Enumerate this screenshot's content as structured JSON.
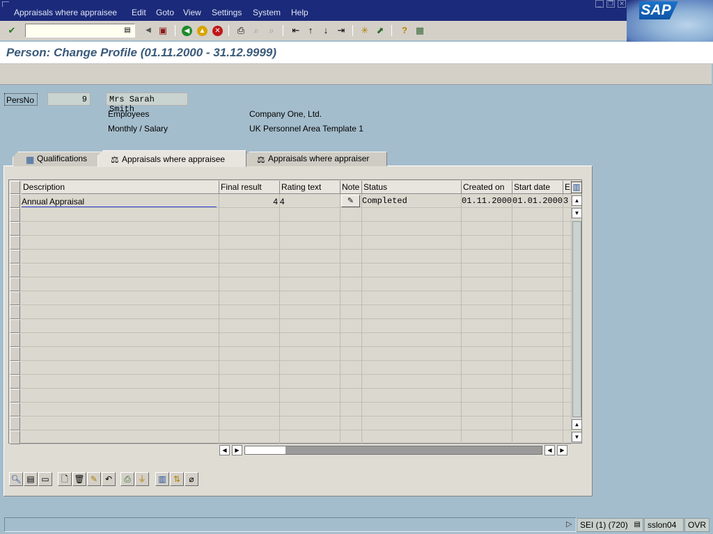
{
  "menubar": {
    "items": [
      "Appraisals where appraisee",
      "Edit",
      "Goto",
      "View",
      "Settings",
      "System",
      "Help"
    ],
    "logo": "SAP",
    "window_controls": [
      "minimize-icon",
      "restore-icon",
      "close-icon"
    ]
  },
  "toolbar": {
    "command_value": "",
    "icons": [
      "enter-check-icon",
      "command-dropdown-icon",
      "expand-left-icon",
      "save-icon",
      "back-icon",
      "exit-icon",
      "cancel-icon",
      "print-icon",
      "find-icon",
      "find-next-icon",
      "first-page-icon",
      "previous-page-icon",
      "next-page-icon",
      "last-page-icon",
      "create-session-icon",
      "shortcut-icon",
      "help-icon",
      "customize-layout-icon"
    ]
  },
  "page": {
    "title": "Person: Change Profile (01.11.2000 - 31.12.9999)"
  },
  "header": {
    "persno_label": "PersNo",
    "persno_value": "9",
    "person_name": "Mrs Sarah Smith",
    "employee_group": "Employees",
    "employee_subgroup": "Monthly / Salary",
    "company": "Company One, Ltd.",
    "personnel_area": "UK Personnel Area Template 1"
  },
  "tabs": [
    {
      "label": "Qualifications",
      "icon": "qualifications-grid-icon",
      "active": false
    },
    {
      "label": "Appraisals where appraisee",
      "icon": "appraisal-scale-icon",
      "active": true
    },
    {
      "label": "Appraisals where appraiser",
      "icon": "appraisal-scale-icon",
      "active": false
    }
  ],
  "table": {
    "columns": [
      "Description",
      "Final result",
      "Rating text",
      "Note",
      "Status",
      "Created on",
      "Start date",
      "E"
    ],
    "rows": [
      {
        "description": "Annual Appraisal",
        "final_result": "4",
        "rating_text": "4",
        "note_icon": "note-icon",
        "status": "Completed",
        "created_on": "01.11.2000",
        "start_date": "01.01.2000",
        "extra": "3"
      }
    ],
    "empty_row_count": 17
  },
  "table_toolbar": {
    "icons": [
      "detail-icon",
      "select-all-icon",
      "deselect-all-icon",
      "create-icon",
      "delete-icon",
      "edit-pencil-icon",
      "undo-icon",
      "print-icon",
      "filter-icon",
      "column-layout-icon",
      "sort-icon",
      "deactivate-icon"
    ]
  },
  "statusbar": {
    "message": "",
    "system": "SEI (1) (720)",
    "server": "sslon04",
    "mode": "OVR"
  },
  "colors": {
    "menubar_bg": "#1b2a7a",
    "background": "#a4bdcc",
    "title_text": "#3a5a7a",
    "panel_bg": "#dfdcd4"
  }
}
